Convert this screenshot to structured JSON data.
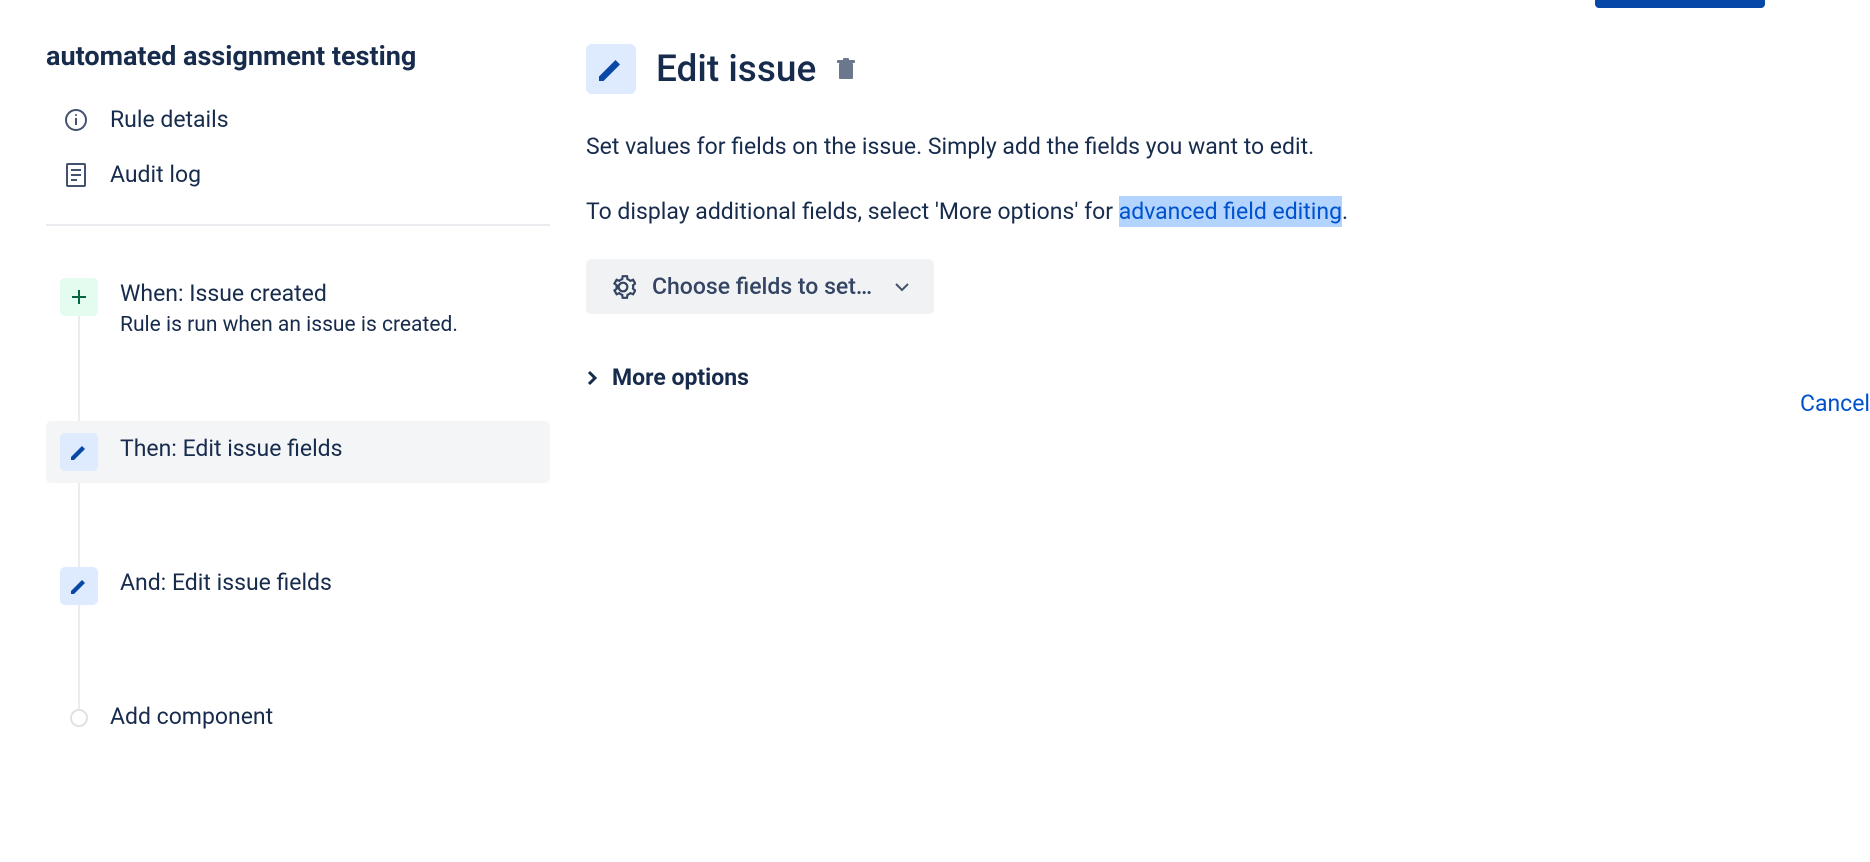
{
  "ruleTitle": "automated assignment testing",
  "nav": {
    "ruleDetails": "Rule details",
    "auditLog": "Audit log"
  },
  "steps": {
    "when": {
      "title": "When: Issue created",
      "sub": "Rule is run when an issue is created."
    },
    "then": {
      "title": "Then: Edit issue fields"
    },
    "and": {
      "title": "And: Edit issue fields"
    },
    "add": {
      "title": "Add component"
    }
  },
  "panel": {
    "title": "Edit issue",
    "desc1": "Set values for fields on the issue. Simply add the fields you want to edit.",
    "desc2a": "To display additional fields, select 'More options' for ",
    "desc2link": "advanced field editing",
    "choose": "Choose fields to set…",
    "moreOptions": "More options",
    "cancel": "Cancel"
  }
}
